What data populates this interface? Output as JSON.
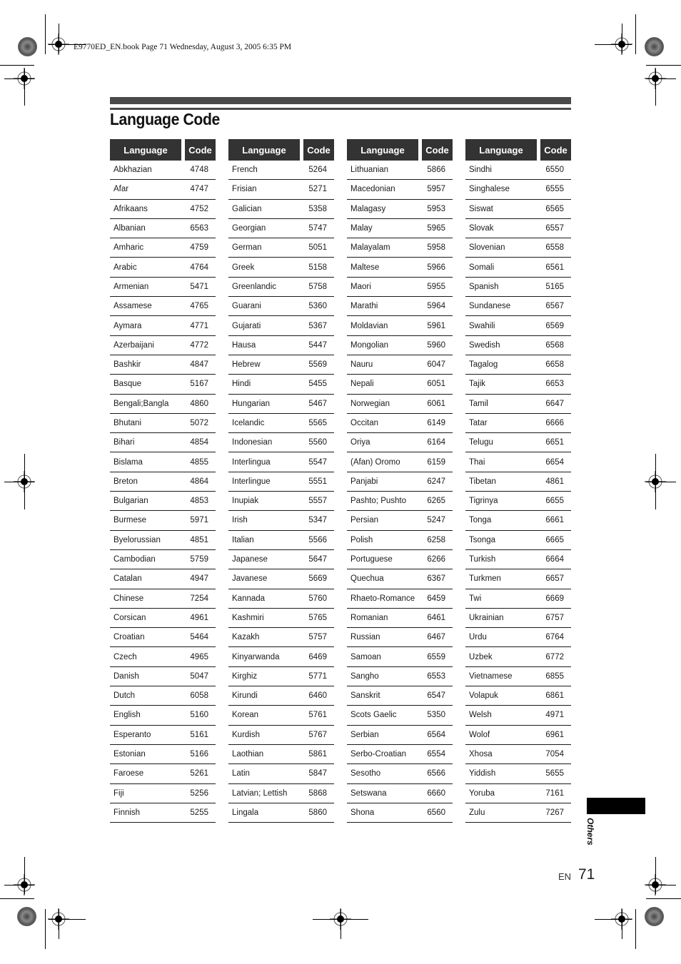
{
  "print_header": "E9770ED_EN.book  Page 71  Wednesday, August 3, 2005  6:35 PM",
  "title": "Language Code",
  "column_headers": {
    "language": "Language",
    "code": "Code"
  },
  "tables": [
    {
      "rows": [
        {
          "language": "Abkhazian",
          "code": "4748"
        },
        {
          "language": "Afar",
          "code": "4747"
        },
        {
          "language": "Afrikaans",
          "code": "4752"
        },
        {
          "language": "Albanian",
          "code": "6563"
        },
        {
          "language": "Amharic",
          "code": "4759"
        },
        {
          "language": "Arabic",
          "code": "4764"
        },
        {
          "language": "Armenian",
          "code": "5471"
        },
        {
          "language": "Assamese",
          "code": "4765"
        },
        {
          "language": "Aymara",
          "code": "4771"
        },
        {
          "language": "Azerbaijani",
          "code": "4772"
        },
        {
          "language": "Bashkir",
          "code": "4847"
        },
        {
          "language": "Basque",
          "code": "5167"
        },
        {
          "language": "Bengali;Bangla",
          "code": "4860"
        },
        {
          "language": "Bhutani",
          "code": "5072"
        },
        {
          "language": "Bihari",
          "code": "4854"
        },
        {
          "language": "Bislama",
          "code": "4855"
        },
        {
          "language": "Breton",
          "code": "4864"
        },
        {
          "language": "Bulgarian",
          "code": "4853"
        },
        {
          "language": "Burmese",
          "code": "5971"
        },
        {
          "language": "Byelorussian",
          "code": "4851"
        },
        {
          "language": "Cambodian",
          "code": "5759"
        },
        {
          "language": "Catalan",
          "code": "4947"
        },
        {
          "language": "Chinese",
          "code": "7254"
        },
        {
          "language": "Corsican",
          "code": "4961"
        },
        {
          "language": "Croatian",
          "code": "5464"
        },
        {
          "language": "Czech",
          "code": "4965"
        },
        {
          "language": "Danish",
          "code": "5047"
        },
        {
          "language": "Dutch",
          "code": "6058"
        },
        {
          "language": "English",
          "code": "5160"
        },
        {
          "language": "Esperanto",
          "code": "5161"
        },
        {
          "language": "Estonian",
          "code": "5166"
        },
        {
          "language": "Faroese",
          "code": "5261"
        },
        {
          "language": "Fiji",
          "code": "5256"
        },
        {
          "language": "Finnish",
          "code": "5255"
        }
      ]
    },
    {
      "rows": [
        {
          "language": "French",
          "code": "5264"
        },
        {
          "language": "Frisian",
          "code": "5271"
        },
        {
          "language": "Galician",
          "code": "5358"
        },
        {
          "language": "Georgian",
          "code": "5747"
        },
        {
          "language": "German",
          "code": "5051"
        },
        {
          "language": "Greek",
          "code": "5158"
        },
        {
          "language": "Greenlandic",
          "code": "5758"
        },
        {
          "language": "Guarani",
          "code": "5360"
        },
        {
          "language": "Gujarati",
          "code": "5367"
        },
        {
          "language": "Hausa",
          "code": "5447"
        },
        {
          "language": "Hebrew",
          "code": "5569"
        },
        {
          "language": "Hindi",
          "code": "5455"
        },
        {
          "language": "Hungarian",
          "code": "5467"
        },
        {
          "language": "Icelandic",
          "code": "5565"
        },
        {
          "language": "Indonesian",
          "code": "5560"
        },
        {
          "language": "Interlingua",
          "code": "5547"
        },
        {
          "language": "Interlingue",
          "code": "5551"
        },
        {
          "language": "Inupiak",
          "code": "5557"
        },
        {
          "language": "Irish",
          "code": "5347"
        },
        {
          "language": "Italian",
          "code": "5566"
        },
        {
          "language": "Japanese",
          "code": "5647"
        },
        {
          "language": "Javanese",
          "code": "5669"
        },
        {
          "language": "Kannada",
          "code": "5760"
        },
        {
          "language": "Kashmiri",
          "code": "5765"
        },
        {
          "language": "Kazakh",
          "code": "5757"
        },
        {
          "language": "Kinyarwanda",
          "code": "6469"
        },
        {
          "language": "Kirghiz",
          "code": "5771"
        },
        {
          "language": "Kirundi",
          "code": "6460"
        },
        {
          "language": "Korean",
          "code": "5761"
        },
        {
          "language": "Kurdish",
          "code": "5767"
        },
        {
          "language": "Laothian",
          "code": "5861"
        },
        {
          "language": "Latin",
          "code": "5847"
        },
        {
          "language": "Latvian; Lettish",
          "code": "5868"
        },
        {
          "language": "Lingala",
          "code": "5860"
        }
      ]
    },
    {
      "rows": [
        {
          "language": "Lithuanian",
          "code": "5866"
        },
        {
          "language": "Macedonian",
          "code": "5957"
        },
        {
          "language": "Malagasy",
          "code": "5953"
        },
        {
          "language": "Malay",
          "code": "5965"
        },
        {
          "language": "Malayalam",
          "code": "5958"
        },
        {
          "language": "Maltese",
          "code": "5966"
        },
        {
          "language": "Maori",
          "code": "5955"
        },
        {
          "language": "Marathi",
          "code": "5964"
        },
        {
          "language": "Moldavian",
          "code": "5961"
        },
        {
          "language": "Mongolian",
          "code": "5960"
        },
        {
          "language": "Nauru",
          "code": "6047"
        },
        {
          "language": "Nepali",
          "code": "6051"
        },
        {
          "language": "Norwegian",
          "code": "6061"
        },
        {
          "language": "Occitan",
          "code": "6149"
        },
        {
          "language": "Oriya",
          "code": "6164"
        },
        {
          "language": "(Afan) Oromo",
          "code": "6159"
        },
        {
          "language": "Panjabi",
          "code": "6247"
        },
        {
          "language": "Pashto; Pushto",
          "code": "6265"
        },
        {
          "language": "Persian",
          "code": "5247"
        },
        {
          "language": "Polish",
          "code": "6258"
        },
        {
          "language": "Portuguese",
          "code": "6266"
        },
        {
          "language": "Quechua",
          "code": "6367"
        },
        {
          "language": "Rhaeto-Romance",
          "code": "6459"
        },
        {
          "language": "Romanian",
          "code": "6461"
        },
        {
          "language": "Russian",
          "code": "6467"
        },
        {
          "language": "Samoan",
          "code": "6559"
        },
        {
          "language": "Sangho",
          "code": "6553"
        },
        {
          "language": "Sanskrit",
          "code": "6547"
        },
        {
          "language": "Scots Gaelic",
          "code": "5350"
        },
        {
          "language": "Serbian",
          "code": "6564"
        },
        {
          "language": "Serbo-Croatian",
          "code": "6554"
        },
        {
          "language": "Sesotho",
          "code": "6566"
        },
        {
          "language": "Setswana",
          "code": "6660"
        },
        {
          "language": "Shona",
          "code": "6560"
        }
      ]
    },
    {
      "rows": [
        {
          "language": "Sindhi",
          "code": "6550"
        },
        {
          "language": "Singhalese",
          "code": "6555"
        },
        {
          "language": "Siswat",
          "code": "6565"
        },
        {
          "language": "Slovak",
          "code": "6557"
        },
        {
          "language": "Slovenian",
          "code": "6558"
        },
        {
          "language": "Somali",
          "code": "6561"
        },
        {
          "language": "Spanish",
          "code": "5165"
        },
        {
          "language": "Sundanese",
          "code": "6567"
        },
        {
          "language": "Swahili",
          "code": "6569"
        },
        {
          "language": "Swedish",
          "code": "6568"
        },
        {
          "language": "Tagalog",
          "code": "6658"
        },
        {
          "language": "Tajik",
          "code": "6653"
        },
        {
          "language": "Tamil",
          "code": "6647"
        },
        {
          "language": "Tatar",
          "code": "6666"
        },
        {
          "language": "Telugu",
          "code": "6651"
        },
        {
          "language": "Thai",
          "code": "6654"
        },
        {
          "language": "Tibetan",
          "code": "4861"
        },
        {
          "language": "Tigrinya",
          "code": "6655"
        },
        {
          "language": "Tonga",
          "code": "6661"
        },
        {
          "language": "Tsonga",
          "code": "6665"
        },
        {
          "language": "Turkish",
          "code": "6664"
        },
        {
          "language": "Turkmen",
          "code": "6657"
        },
        {
          "language": "Twi",
          "code": "6669"
        },
        {
          "language": "Ukrainian",
          "code": "6757"
        },
        {
          "language": "Urdu",
          "code": "6764"
        },
        {
          "language": "Uzbek",
          "code": "6772"
        },
        {
          "language": "Vietnamese",
          "code": "6855"
        },
        {
          "language": "Volapuk",
          "code": "6861"
        },
        {
          "language": "Welsh",
          "code": "4971"
        },
        {
          "language": "Wolof",
          "code": "6961"
        },
        {
          "language": "Xhosa",
          "code": "7054"
        },
        {
          "language": "Yiddish",
          "code": "5655"
        },
        {
          "language": "Yoruba",
          "code": "7161"
        },
        {
          "language": "Zulu",
          "code": "7267"
        }
      ]
    }
  ],
  "section_tab": "Others",
  "footer": {
    "lang": "EN",
    "page": "71"
  },
  "colors": {
    "header_bg": "#333333",
    "header_text": "#ffffff",
    "rule": "#4a4a4a"
  }
}
